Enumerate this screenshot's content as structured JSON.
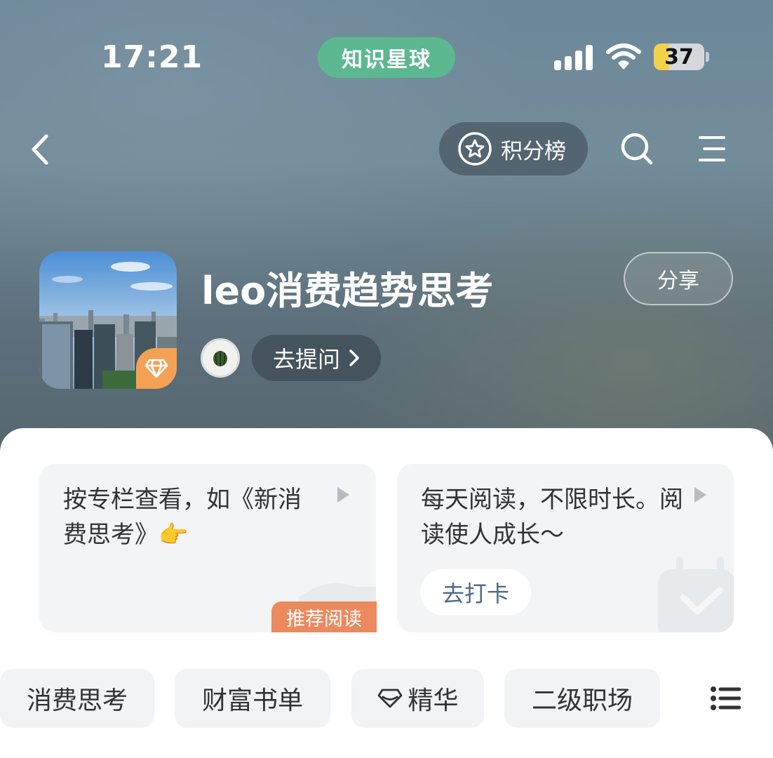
{
  "status_bar": {
    "time": "17:21",
    "app_name": "知识星球",
    "battery": "37"
  },
  "nav": {
    "ranking_label": "积分榜"
  },
  "group": {
    "title": "leo消费趋势思考",
    "share_label": "分享",
    "ask_label": "去提问"
  },
  "cards": [
    {
      "text": "按专栏查看，如《新消费思考》👉",
      "tag": "推荐阅读"
    },
    {
      "text": "每天阅读，不限时长。阅读使人成长～",
      "button": "去打卡"
    }
  ],
  "tabs": [
    {
      "label": "消费思考"
    },
    {
      "label": "财富书单"
    },
    {
      "label": "精华",
      "icon": "diamond-icon"
    },
    {
      "label": "二级职场"
    }
  ],
  "colors": {
    "app_pill": "#5bb890",
    "recommend_tag": "#ec8a5e",
    "gem_badge": "#f4a055",
    "checkin_text": "#4e6a86"
  }
}
